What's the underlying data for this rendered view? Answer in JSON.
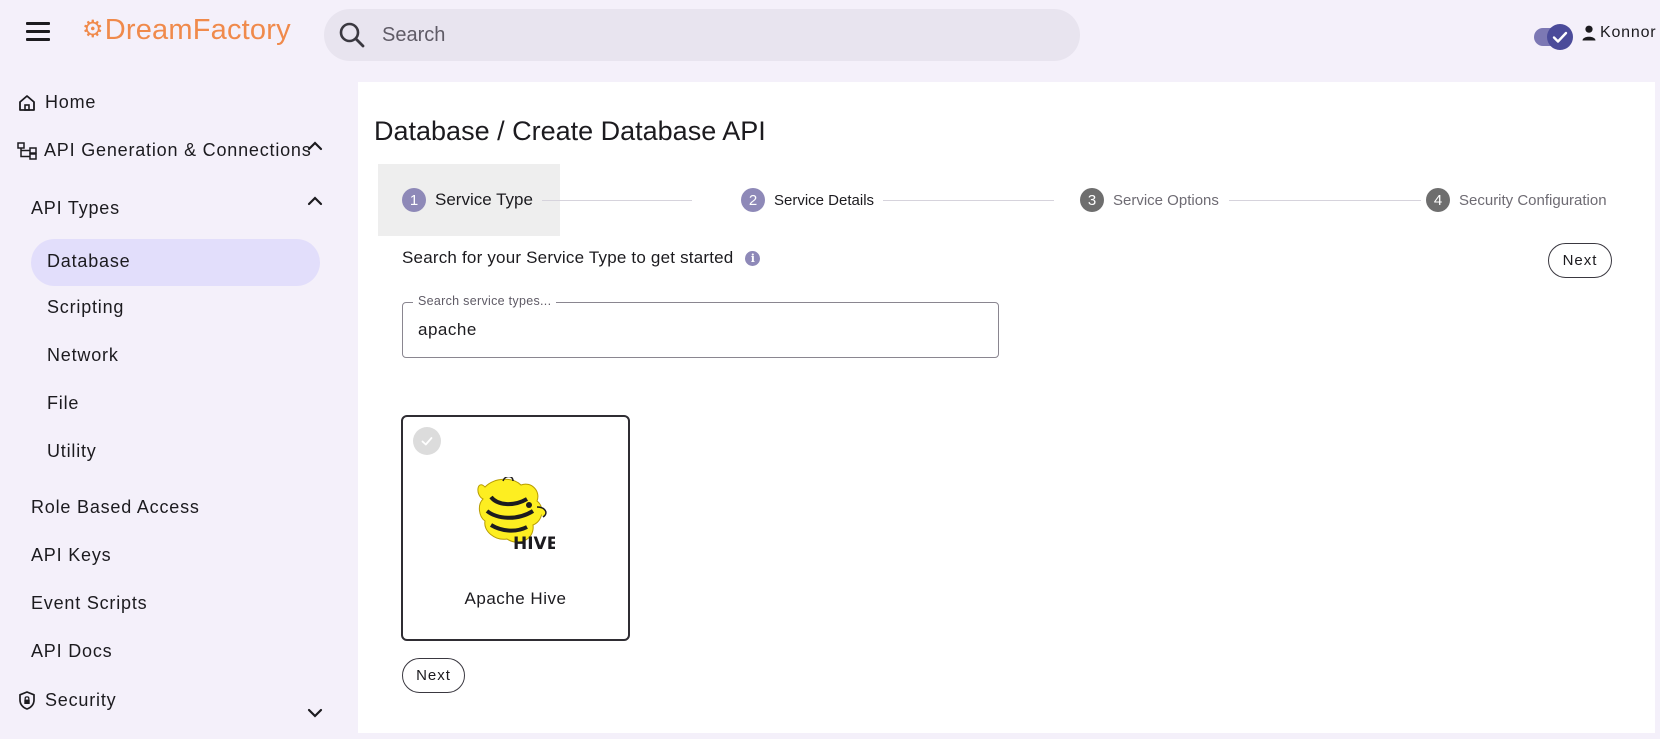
{
  "header": {
    "brand": "DreamFactory",
    "search_placeholder": "Search",
    "user_name": "Konnor",
    "theme_toggle_on": true
  },
  "sidebar": {
    "home": "Home",
    "api_generation": "API Generation & Connections",
    "api_types": "API Types",
    "types": [
      "Database",
      "Scripting",
      "Network",
      "File",
      "Utility"
    ],
    "active_type": "Database",
    "role_based_access": "Role Based Access",
    "api_keys": "API Keys",
    "event_scripts": "Event Scripts",
    "api_docs": "API Docs",
    "security": "Security"
  },
  "main": {
    "title": "Database / Create Database API",
    "steps": [
      {
        "num": "1",
        "label": "Service Type",
        "state": "active"
      },
      {
        "num": "2",
        "label": "Service Details",
        "state": "next"
      },
      {
        "num": "3",
        "label": "Service Options",
        "state": "pending"
      },
      {
        "num": "4",
        "label": "Security Configuration",
        "state": "pending"
      }
    ],
    "hint": "Search for your Service Type to get started",
    "next_label": "Next",
    "search_field": {
      "label": "Search service types...",
      "value": "apache"
    },
    "results": [
      {
        "name": "Apache Hive",
        "logo_text": "HIVE",
        "selected": false
      }
    ]
  },
  "colors": {
    "brand": "#f08a4b",
    "active_nav_bg": "#e2defb",
    "page_bg": "#f4f0fa",
    "step_active": "#8e89b8",
    "step_pending": "#6e6e6e"
  }
}
